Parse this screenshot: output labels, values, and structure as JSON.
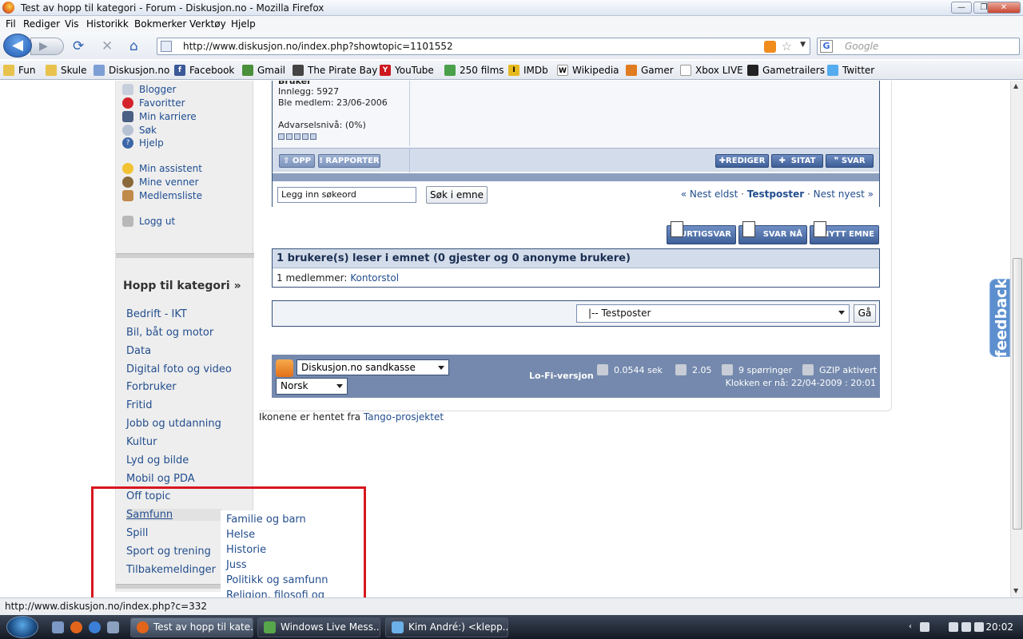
{
  "window": {
    "title": "Test av hopp til kategori - Forum - Diskusjon.no - Mozilla Firefox",
    "min_glyph": "—",
    "max_glyph": "❐",
    "close_glyph": "✕"
  },
  "menu": [
    "Fil",
    "Rediger",
    "Vis",
    "Historikk",
    "Bokmerker",
    "Verktøy",
    "Hjelp"
  ],
  "nav": {
    "back_glyph": "◀",
    "forward_glyph": "▶",
    "url": "http://www.diskusjon.no/index.php?showtopic=1101552",
    "search_placeholder": "Google",
    "search_engine_glyph": "G"
  },
  "bookmarks": [
    "Fun",
    "Skule",
    "Diskusjon.no",
    "Facebook",
    "Gmail",
    "The Pirate Bay",
    "YouTube",
    "250 films",
    "IMDb",
    "Wikipedia",
    "Gamer",
    "Xbox LIVE",
    "Gametrailers",
    "Twitter"
  ],
  "sidebar": {
    "links": [
      "Blogger",
      "Favoritter",
      "Min karriere",
      "Søk",
      "Hjelp",
      "Min assistent",
      "Mine venner",
      "Medlemsliste",
      "Logg ut"
    ],
    "jump_title": "Hopp til kategori »",
    "categories": [
      "Bedrift - IKT",
      "Bil, båt og motor",
      "Data",
      "Digital foto og video",
      "Forbruker",
      "Fritid",
      "Jobb og utdanning",
      "Kultur",
      "Lyd og bilde",
      "Mobil og PDA",
      "Off topic",
      "Samfunn",
      "Spill",
      "Sport og trening",
      "Tilbakemeldinger"
    ],
    "active_category": "Samfunn",
    "submenu": [
      "Familie og barn",
      "Helse",
      "Historie",
      "Juss",
      "Politikk og samfunn",
      "Religion, filosofi og"
    ]
  },
  "post": {
    "role": "Bruker",
    "posts": "Innlegg: 5927",
    "joined": "Ble medlem: 23/06-2006",
    "warning": "Advarselsnivå: (0%)",
    "btn_up": "OPP",
    "btn_report": "RAPPORTER",
    "btn_edit": "REDIGER",
    "btn_quote": "SITAT",
    "btn_reply": "SVAR"
  },
  "search_row": {
    "keyword_value": "Legg inn søkeord",
    "search_btn": "Søk i emne",
    "prev": "« Nest eldst",
    "sep1": "·",
    "current": "Testposter",
    "sep2": "·",
    "next": "Nest nyest »"
  },
  "actions": {
    "quick_reply": "HURTIGSVAR",
    "reply_now": "SVAR NÅ",
    "new_topic": "NYTT EMNE"
  },
  "readers": {
    "header": "1 brukere(s) leser i emnet (0 gjester og 0 anonyme brukere)",
    "members_label": "1 medlemmer:",
    "member": "Kontorstol"
  },
  "jump": {
    "selected": "|-- Testposter",
    "go_btn": "Gå"
  },
  "footer": {
    "skin": "Diskusjon.no sandkasse",
    "language": "Norsk",
    "lofi": "Lo-Fi-versjon",
    "time": "0.0544 sek",
    "load": "2.05",
    "queries": "9 spørringer",
    "gzip": "GZIP aktivert",
    "clock": "Klokken er nå: 22/04-2009 : 20:01"
  },
  "credits": {
    "text": "Ikonene er hentet fra",
    "link": "Tango-prosjektet"
  },
  "feedback": "feedback",
  "status": "http://www.diskusjon.no/index.php?c=332",
  "taskbar": {
    "tasks": [
      "Test av hopp til kate...",
      "Windows Live Mess...",
      "Kim André:) <klepp..."
    ],
    "clock": "20:02"
  },
  "colors": {
    "link": "#234e8e",
    "forum_border": "#36527a",
    "highlight": "#d7161f",
    "footer_bg": "#7489ad"
  }
}
